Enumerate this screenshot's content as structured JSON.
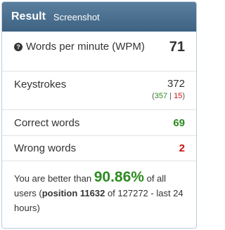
{
  "header": {
    "title": "Result",
    "tab": "Screenshot"
  },
  "stats": {
    "wpm_label": "Words per minute (WPM)",
    "wpm_value": "71",
    "keystrokes_label": "Keystrokes",
    "keystrokes_value": "372",
    "keystrokes_correct": "357",
    "keystrokes_separator": "|",
    "keystrokes_wrong": "15",
    "correct_words_label": "Correct words",
    "correct_words_value": "69",
    "wrong_words_label": "Wrong words",
    "wrong_words_value": "2"
  },
  "summary": {
    "prefix": "You are better than",
    "percent": "90.86%",
    "middle": "of all users (",
    "position": "position 11632",
    "suffix": "of 127272 - last 24 hours)"
  },
  "colors": {
    "header_bg": "#4a7091",
    "positive": "#2e8b22",
    "negative": "#cc1111"
  },
  "icons": {
    "wpm_help": "question-circle-icon"
  }
}
